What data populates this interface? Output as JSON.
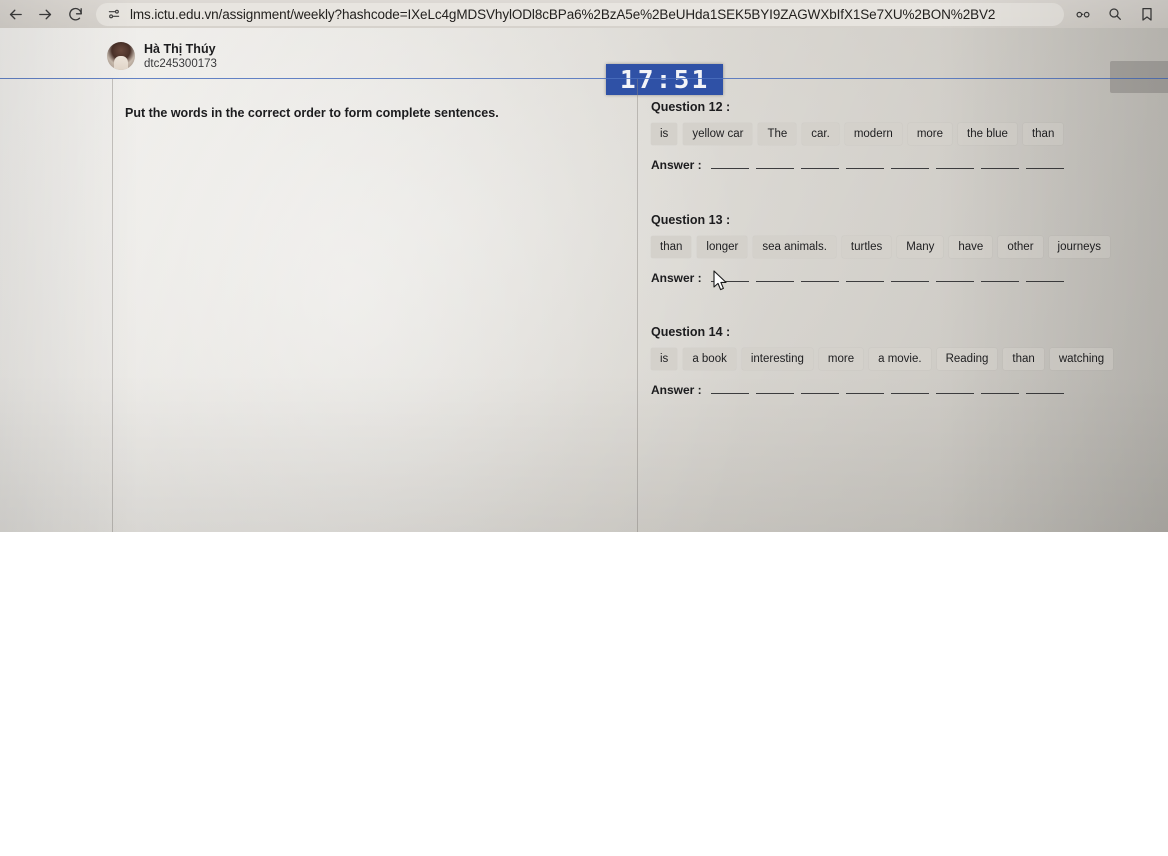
{
  "browser": {
    "back_icon": "back-arrow-icon",
    "forward_icon": "forward-arrow-icon",
    "reload_icon": "reload-icon",
    "site_settings_icon": "site-settings-icon",
    "url": "lms.ictu.edu.vn/assignment/weekly?hashcode=IXeLc4gMDSVhylODl8cBPa6%2BzA5e%2BeUHda1SEK5BYI9ZAGWXbIfX1Se7XU%2BON%2BV2",
    "right_icons": [
      "glasses-icon",
      "search-icon",
      "bookmark-icon"
    ]
  },
  "header": {
    "avatar": "user-avatar",
    "user_name": "Hà Thị Thúy",
    "user_id": "dtc245300173",
    "timer": "17:51",
    "timer_color": "#2f51a6"
  },
  "main": {
    "instruction": "Put the words in the correct order to form complete sentences.",
    "answer_label": "Answer :",
    "questions": [
      {
        "title": "Question 12 :",
        "tiles": [
          "is",
          "yellow car",
          "The",
          "car.",
          "modern",
          "more",
          "the blue",
          "than"
        ],
        "blanks": 8
      },
      {
        "title": "Question 13 :",
        "tiles": [
          "than",
          "longer",
          "sea animals.",
          "turtles",
          "Many",
          "have",
          "other",
          "journeys"
        ],
        "blanks": 8
      },
      {
        "title": "Question 14 :",
        "tiles": [
          "is",
          "a book",
          "interesting",
          "more",
          "a movie.",
          "Reading",
          "than",
          "watching"
        ],
        "blanks": 8
      }
    ]
  },
  "colors": {
    "tile_background": "#d4d1cb",
    "rule_blue": "#4a6fbd",
    "page_background": "#e4e1db"
  }
}
